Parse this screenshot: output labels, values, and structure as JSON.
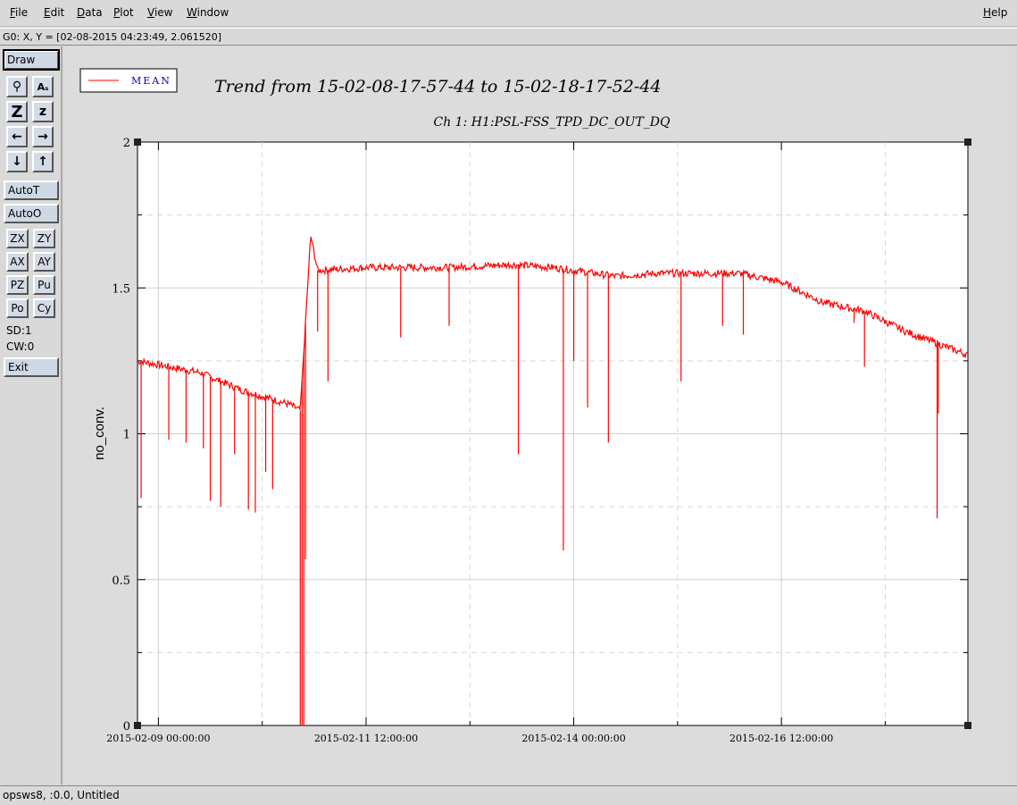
{
  "menubar": {
    "items": [
      {
        "label": "File",
        "mnemonic": "F",
        "rest": "ile"
      },
      {
        "label": "Edit",
        "mnemonic": "E",
        "rest": "dit"
      },
      {
        "label": "Data",
        "mnemonic": "D",
        "rest": "ata"
      },
      {
        "label": "Plot",
        "mnemonic": "P",
        "rest": "lot"
      },
      {
        "label": "View",
        "mnemonic": "V",
        "rest": "iew"
      },
      {
        "label": "Window",
        "mnemonic": "W",
        "rest": "indow"
      }
    ],
    "help": {
      "label": "Help",
      "mnemonic": "H",
      "rest": "elp"
    }
  },
  "coord_readout": "G0: X, Y = [02-08-2015 04:23:49, 2.061520]",
  "toolbar": {
    "draw": "Draw",
    "icons": [
      {
        "name": "magnifier-icon",
        "glyph": "⚲"
      },
      {
        "name": "text-style-icon",
        "glyph": "Aₛ"
      },
      {
        "name": "zoom-in-icon",
        "glyph": "Z"
      },
      {
        "name": "zoom-out-icon",
        "glyph": "z"
      },
      {
        "name": "arrow-left-icon",
        "glyph": "←"
      },
      {
        "name": "arrow-right-icon",
        "glyph": "→"
      },
      {
        "name": "arrow-down-icon",
        "glyph": "↓"
      },
      {
        "name": "arrow-up-icon",
        "glyph": "↑"
      }
    ],
    "auto_t": "AutoT",
    "auto_o": "AutoO",
    "pairs": [
      [
        "ZX",
        "ZY"
      ],
      [
        "AX",
        "AY"
      ],
      [
        "PZ",
        "Pu"
      ],
      [
        "Po",
        "Cy"
      ]
    ],
    "sd": "SD:1",
    "cw": "CW:0",
    "exit": "Exit"
  },
  "status": "opsws8, :0.0, Untitled",
  "colors": {
    "series": "#ff0000",
    "legend_text": "#0000cc",
    "grid": "#d0d0d0"
  },
  "chart_data": {
    "type": "line",
    "title": "Trend from 15-02-08-17-57-44 to 15-02-18-17-52-44",
    "subtitle": "Ch 1: H1:PSL-FSS_TPD_DC_OUT_DQ",
    "ylabel": "no_conv.",
    "xlabel": "",
    "legend": {
      "entries": [
        "MEAN"
      ],
      "placement": "top-left"
    },
    "grid": true,
    "x_axis": {
      "type": "time",
      "range": [
        "2015-02-08 17:57:44",
        "2015-02-18 17:52:44"
      ],
      "tick_labels": [
        "2015-02-09 00:00:00",
        "2015-02-11 12:00:00",
        "2015-02-14 00:00:00",
        "2015-02-16 12:00:00"
      ]
    },
    "ylim": [
      0,
      2
    ],
    "y_ticks": [
      "0",
      "0.5",
      "1",
      "1.5",
      "2"
    ],
    "series": [
      {
        "name": "MEAN",
        "baseline": [
          [
            "2015-02-08 17:57:44",
            1.25
          ],
          [
            "2015-02-09 12:00:00",
            1.21
          ],
          [
            "2015-02-10 00:00:00",
            1.15
          ],
          [
            "2015-02-10 14:00:00",
            1.1
          ],
          [
            "2015-02-10 17:00:00",
            1.08
          ],
          [
            "2015-02-10 20:00:00",
            1.68
          ],
          [
            "2015-02-10 22:00:00",
            1.56
          ],
          [
            "2015-02-11 12:00:00",
            1.57
          ],
          [
            "2015-02-12 12:00:00",
            1.57
          ],
          [
            "2015-02-13 06:00:00",
            1.58
          ],
          [
            "2015-02-13 18:00:00",
            1.57
          ],
          [
            "2015-02-14 12:00:00",
            1.54
          ],
          [
            "2015-02-15 00:00:00",
            1.55
          ],
          [
            "2015-02-16 00:00:00",
            1.55
          ],
          [
            "2015-02-16 12:00:00",
            1.52
          ],
          [
            "2015-02-17 00:00:00",
            1.45
          ],
          [
            "2015-02-17 12:00:00",
            1.42
          ],
          [
            "2015-02-18 00:00:00",
            1.35
          ],
          [
            "2015-02-18 17:52:44",
            1.27
          ]
        ],
        "spikes": [
          [
            "2015-02-08 19:00:00",
            0.78
          ],
          [
            "2015-02-09 03:00:00",
            0.98
          ],
          [
            "2015-02-09 08:00:00",
            0.97
          ],
          [
            "2015-02-09 13:00:00",
            0.95
          ],
          [
            "2015-02-09 15:00:00",
            0.77
          ],
          [
            "2015-02-09 18:00:00",
            0.75
          ],
          [
            "2015-02-09 22:00:00",
            0.93
          ],
          [
            "2015-02-10 02:00:00",
            0.74
          ],
          [
            "2015-02-10 04:00:00",
            0.73
          ],
          [
            "2015-02-10 07:00:00",
            0.87
          ],
          [
            "2015-02-10 09:00:00",
            0.81
          ],
          [
            "2015-02-10 17:00:00",
            0.0
          ],
          [
            "2015-02-10 17:30:00",
            0.0
          ],
          [
            "2015-02-10 18:00:00",
            0.0
          ],
          [
            "2015-02-10 18:30:00",
            0.57
          ],
          [
            "2015-02-10 22:00:00",
            1.35
          ],
          [
            "2015-02-11 01:00:00",
            1.18
          ],
          [
            "2015-02-11 22:00:00",
            1.33
          ],
          [
            "2015-02-12 12:00:00",
            1.37
          ],
          [
            "2015-02-13 08:00:00",
            0.93
          ],
          [
            "2015-02-13 21:00:00",
            0.6
          ],
          [
            "2015-02-14 00:00:00",
            1.25
          ],
          [
            "2015-02-14 04:00:00",
            1.09
          ],
          [
            "2015-02-14 10:00:00",
            0.97
          ],
          [
            "2015-02-15 07:00:00",
            1.18
          ],
          [
            "2015-02-15 19:00:00",
            1.37
          ],
          [
            "2015-02-16 01:00:00",
            1.34
          ],
          [
            "2015-02-17 09:00:00",
            1.38
          ],
          [
            "2015-02-17 12:00:00",
            1.23
          ],
          [
            "2015-02-18 09:00:00",
            0.71
          ],
          [
            "2015-02-18 09:20:00",
            1.07
          ]
        ]
      }
    ]
  }
}
